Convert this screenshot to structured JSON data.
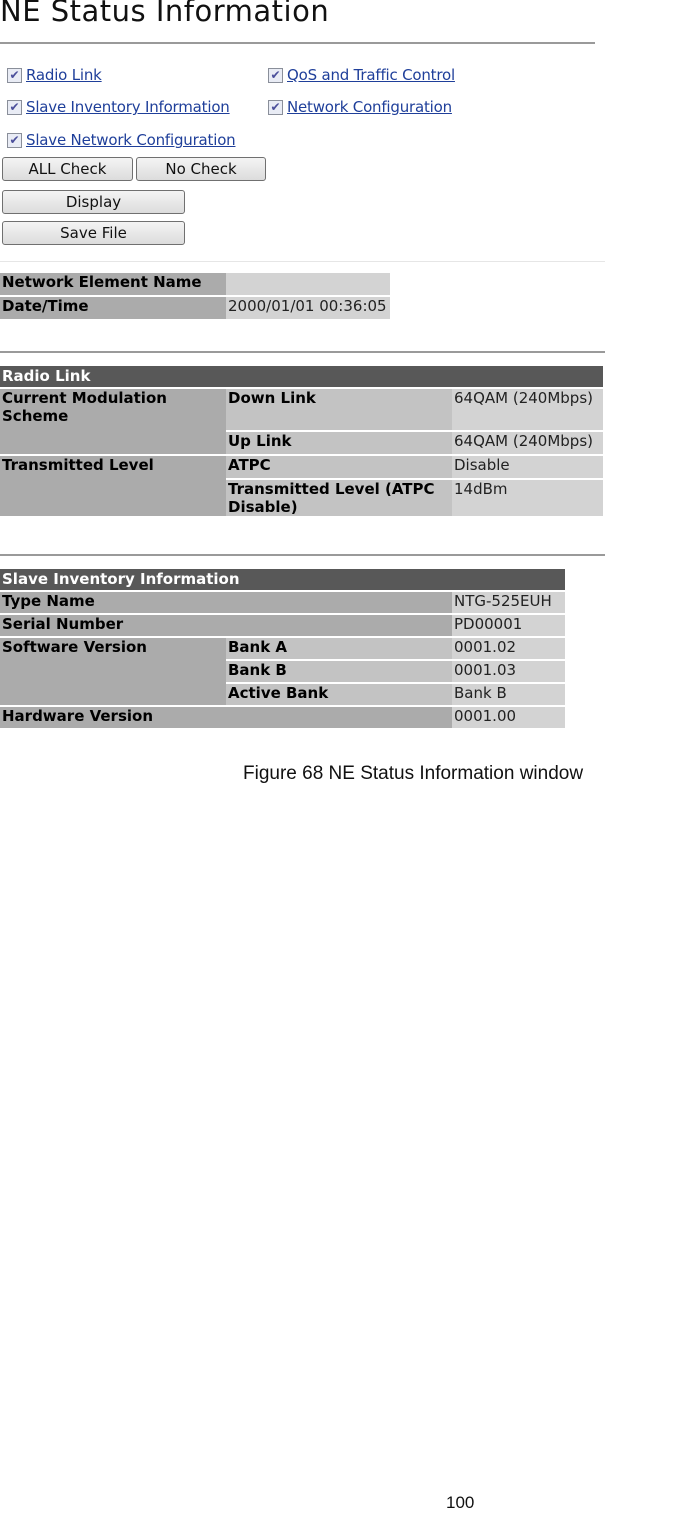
{
  "window": {
    "title": "NE Status Information"
  },
  "checkboxes": [
    {
      "label": "Radio Link",
      "checked": true,
      "icon": "checkbox-checked-icon"
    },
    {
      "label": "QoS and Traffic Control",
      "checked": true,
      "icon": "checkbox-checked-icon"
    },
    {
      "label": "Slave Inventory Information",
      "checked": true,
      "icon": "checkbox-checked-icon"
    },
    {
      "label": "Network Configuration",
      "checked": true,
      "icon": "checkbox-checked-icon"
    },
    {
      "label": "Slave Network Configuration",
      "checked": true,
      "icon": "checkbox-checked-icon"
    }
  ],
  "check_glyph": "✔",
  "buttons": {
    "all_check": "ALL Check",
    "no_check": "No Check",
    "display": "Display",
    "save_file": "Save File"
  },
  "ne_info": {
    "rows": [
      {
        "label": "Network Element Name",
        "value": ""
      },
      {
        "label": "Date/Time",
        "value": "2000/01/01 00:36:05"
      }
    ]
  },
  "radio_link": {
    "title": "Radio Link",
    "groups": [
      {
        "label": "Current Modulation Scheme",
        "items": [
          {
            "label": "Down Link",
            "value": "64QAM (240Mbps)"
          },
          {
            "label": "Up Link",
            "value": "64QAM (240Mbps)"
          }
        ]
      },
      {
        "label": "Transmitted Level",
        "items": [
          {
            "label": "ATPC",
            "value": "Disable"
          },
          {
            "label": "Transmitted Level (ATPC Disable)",
            "value": "14dBm"
          }
        ]
      }
    ]
  },
  "slave_inventory": {
    "title": "Slave Inventory Information",
    "type_name": {
      "label": "Type Name",
      "value": "NTG-525EUH"
    },
    "serial_number": {
      "label": "Serial Number",
      "value": "PD00001"
    },
    "software_version": {
      "label": "Software Version",
      "items": [
        {
          "label": "Bank A",
          "value": "0001.02"
        },
        {
          "label": "Bank B",
          "value": "0001.03"
        },
        {
          "label": "Active Bank",
          "value": "Bank B"
        }
      ]
    },
    "hardware_version": {
      "label": "Hardware Version",
      "value": "0001.00"
    }
  },
  "document": {
    "caption": "Figure 68 NE Status Information window",
    "page_number": "100"
  },
  "colors": {
    "link": "#1f3f9a",
    "section_header_bg": "#585858",
    "label_bg": "#ababab",
    "value_bg": "#d3d3d3"
  }
}
